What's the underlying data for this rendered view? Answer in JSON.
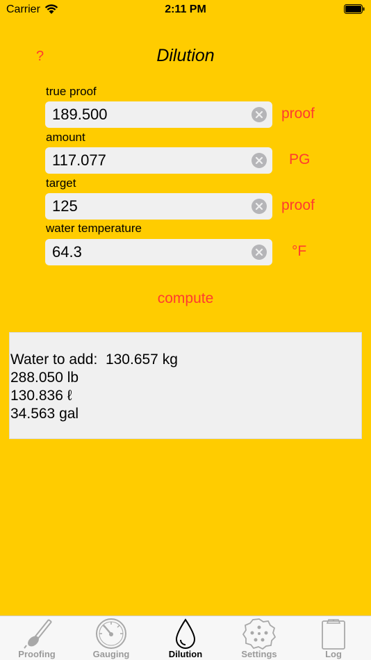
{
  "status_bar": {
    "carrier": "Carrier",
    "time": "2:11 PM"
  },
  "header": {
    "help_label": "?",
    "title": "Dilution"
  },
  "form": {
    "fields": [
      {
        "label": "true proof",
        "value": "189.500",
        "unit": "proof"
      },
      {
        "label": "amount",
        "value": "117.077",
        "unit": "PG"
      },
      {
        "label": "target",
        "value": "125",
        "unit": "proof"
      },
      {
        "label": "water temperature",
        "value": "64.3",
        "unit": "°F"
      }
    ],
    "compute_label": "compute"
  },
  "result": {
    "lines": [
      "Water to add:  130.657 kg",
      "288.050 lb",
      "130.836 ℓ",
      "34.563 gal"
    ]
  },
  "tabs": [
    {
      "label": "Proofing",
      "icon": "hydrometer-icon"
    },
    {
      "label": "Gauging",
      "icon": "gauge-icon"
    },
    {
      "label": "Dilution",
      "icon": "drop-icon"
    },
    {
      "label": "Settings",
      "icon": "settings-icon"
    },
    {
      "label": "Log",
      "icon": "clipboard-icon"
    }
  ],
  "colors": {
    "background": "#FFCC00",
    "accent": "#FF3B30",
    "field_background": "#F0F0F0"
  }
}
